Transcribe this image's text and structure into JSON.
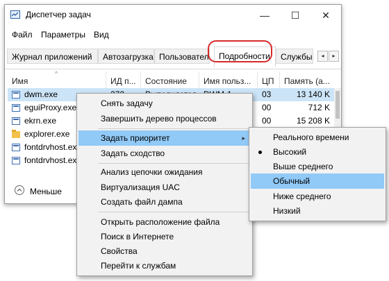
{
  "window": {
    "title": "Диспетчер задач",
    "minimize": "—",
    "maximize": "☐",
    "close": "✕"
  },
  "menubar": [
    "Файл",
    "Параметры",
    "Вид"
  ],
  "tabs": [
    "Журнал приложений",
    "Автозагрузка",
    "Пользователи",
    "Подробности",
    "Службы"
  ],
  "active_tab": "Подробности",
  "tab_scroll": {
    "left": "◂",
    "right": "▸"
  },
  "columns": [
    "Имя",
    "ИД п...",
    "Состояние",
    "Имя польз...",
    "ЦП",
    "Память (а..."
  ],
  "sort_indicator": "^",
  "rows": [
    {
      "name": "dwm.exe",
      "pid": "272",
      "status": "Выполняется",
      "user": "DWM-1",
      "cpu": "03",
      "mem": "13 140 K",
      "selected": true
    },
    {
      "name": "eguiProxy.exe",
      "pid": "",
      "status": "",
      "user": "",
      "cpu": "00",
      "mem": "712 K"
    },
    {
      "name": "ekrn.exe",
      "pid": "",
      "status": "",
      "user": "",
      "cpu": "00",
      "mem": "15 208 K"
    },
    {
      "name": "explorer.exe",
      "pid": "",
      "status": "",
      "user": "",
      "cpu": "",
      "mem": ""
    },
    {
      "name": "fontdrvhost.exe",
      "pid": "",
      "status": "",
      "user": "",
      "cpu": "",
      "mem": ""
    },
    {
      "name": "fontdrvhost.exe",
      "pid": "",
      "status": "",
      "user": "",
      "cpu": "",
      "mem": ""
    }
  ],
  "less_button": "Меньше",
  "context_menu": {
    "items": [
      "Снять задачу",
      "Завершить дерево процессов",
      "Задать приоритет",
      "Задать сходство",
      "Анализ цепочки ожидания",
      "Виртуализация UAC",
      "Создать файл дампа",
      "Открыть расположение файла",
      "Поиск в Интернете",
      "Свойства",
      "Перейти к службам"
    ],
    "highlighted": "Задать приоритет",
    "submenu_arrow": "▸"
  },
  "priority_submenu": {
    "items": [
      "Реального времени",
      "Высокий",
      "Выше среднего",
      "Обычный",
      "Ниже среднего",
      "Низкий"
    ],
    "checked": "Высокий",
    "highlighted": "Обычный"
  },
  "colors": {
    "selection": "#cce4f7",
    "menu_highlight": "#91c9f7",
    "callout": "#d62a2a"
  }
}
